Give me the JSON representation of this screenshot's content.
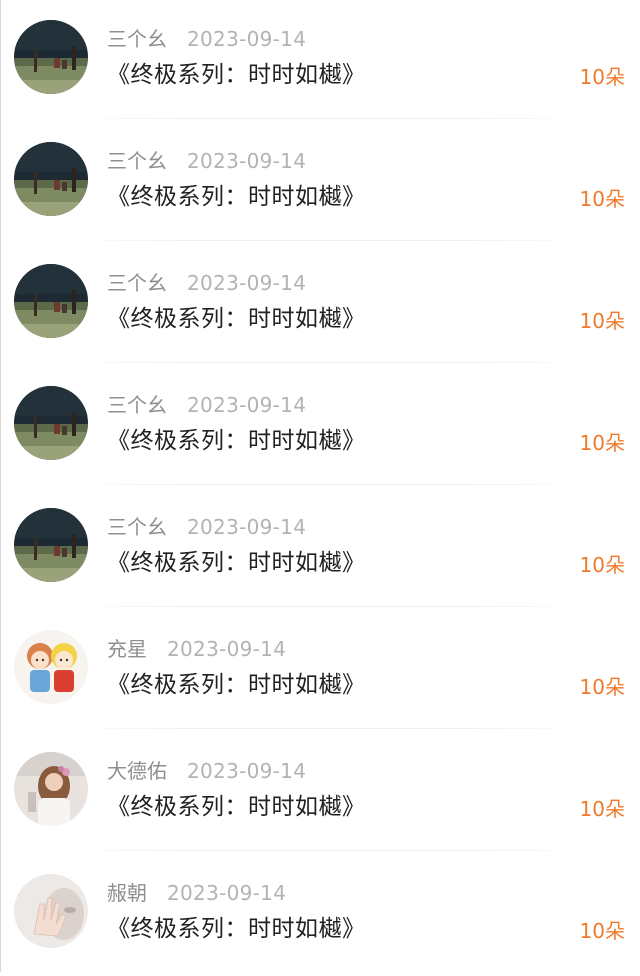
{
  "comments": [
    {
      "user": "三个幺",
      "date": "2023-09-14",
      "title": "《终极系列：时时如樾》",
      "flowers": "10朵",
      "avatar": "field-photo-avatar"
    },
    {
      "user": "三个幺",
      "date": "2023-09-14",
      "title": "《终极系列：时时如樾》",
      "flowers": "10朵",
      "avatar": "field-photo-avatar"
    },
    {
      "user": "三个幺",
      "date": "2023-09-14",
      "title": "《终极系列：时时如樾》",
      "flowers": "10朵",
      "avatar": "field-photo-avatar"
    },
    {
      "user": "三个幺",
      "date": "2023-09-14",
      "title": "《终极系列：时时如樾》",
      "flowers": "10朵",
      "avatar": "field-photo-avatar"
    },
    {
      "user": "三个幺",
      "date": "2023-09-14",
      "title": "《终极系列：时时如樾》",
      "flowers": "10朵",
      "avatar": "field-photo-avatar"
    },
    {
      "user": "充星",
      "date": "2023-09-14",
      "title": "《终极系列：时时如樾》",
      "flowers": "10朵",
      "avatar": "cartoon-kids-avatar"
    },
    {
      "user": "大德佑",
      "date": "2023-09-14",
      "title": "《终极系列：时时如樾》",
      "flowers": "10朵",
      "avatar": "girl-flower-avatar"
    },
    {
      "user": "赧朝",
      "date": "2023-09-14",
      "title": "《终极系列：时时如樾》",
      "flowers": "10朵",
      "avatar": "hand-photo-avatar"
    }
  ],
  "colors": {
    "flower_accent": "#f07a2c",
    "username": "#8f8f8f",
    "date": "#b3b3b3",
    "title": "#222222"
  }
}
